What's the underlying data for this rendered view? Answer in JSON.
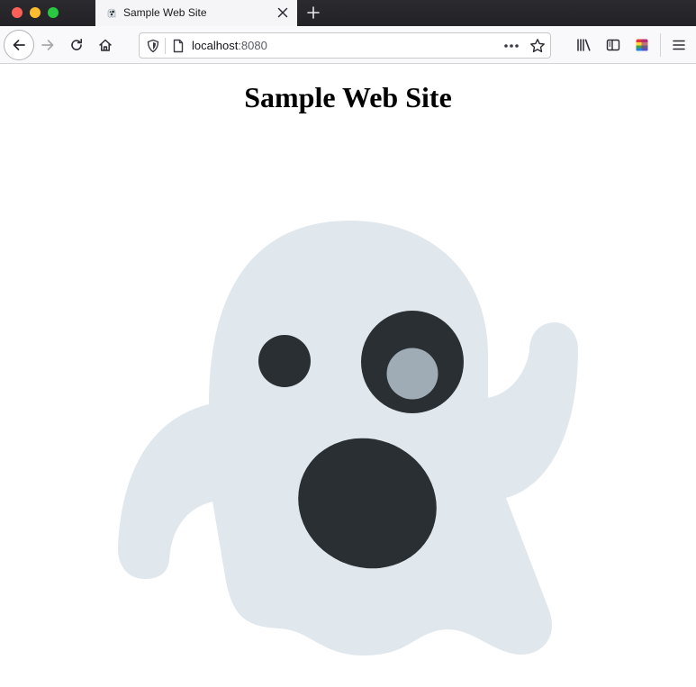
{
  "window": {
    "controls": [
      "close",
      "minimize",
      "zoom"
    ]
  },
  "tab": {
    "title": "Sample Web Site",
    "favicon": "ghost-icon"
  },
  "toolbar": {
    "back_icon": "back-arrow-icon",
    "forward_icon": "forward-arrow-icon",
    "reload_icon": "reload-icon",
    "home_icon": "home-icon",
    "library_icon": "library-icon",
    "sidebar_icon": "sidebar-icon",
    "extension_icon": "extension-icon",
    "menu_icon": "hamburger-menu-icon"
  },
  "urlbar": {
    "host": "localhost",
    "port": ":8080"
  },
  "page": {
    "heading": "Sample Web Site",
    "image": "ghost-emoji"
  },
  "colors": {
    "ghost_body": "#e1e8ed",
    "ghost_features": "#292f33",
    "ghost_pupil": "#a0acb5",
    "tab_strip": "#2b2a2e",
    "toolbar": "#f9f9fb"
  }
}
